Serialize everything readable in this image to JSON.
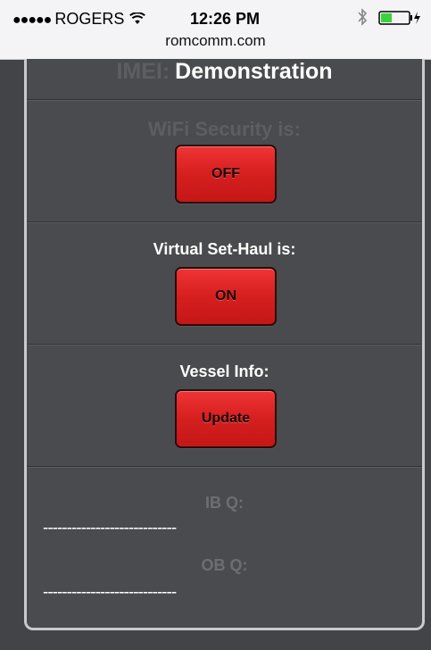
{
  "status_bar": {
    "signal_dots": "●●●●●",
    "carrier": "ROGERS",
    "time": "12:26 PM",
    "icons": [
      "wifi-icon",
      "bluetooth-icon",
      "battery-icon"
    ]
  },
  "browser": {
    "url": "romcomm.com"
  },
  "device": {
    "imei_label": "IMEI:",
    "imei_value": "Demonstration"
  },
  "wifi_security": {
    "title": "WiFi Security is:",
    "button_label": "OFF"
  },
  "virtual_sethaul": {
    "title": "Virtual Set-Haul is:",
    "button_label": "ON"
  },
  "vessel_info": {
    "title": "Vessel Info:",
    "button_label": "Update"
  },
  "queues": {
    "ib_label": "IB Q:",
    "ib_value": "----------------------------",
    "ob_label": "OB Q:",
    "ob_value": "----------------------------"
  },
  "colors": {
    "button_red": "#d61f1f",
    "panel_bg": "#4a4b4e",
    "dim_text": "#5d5e62"
  }
}
